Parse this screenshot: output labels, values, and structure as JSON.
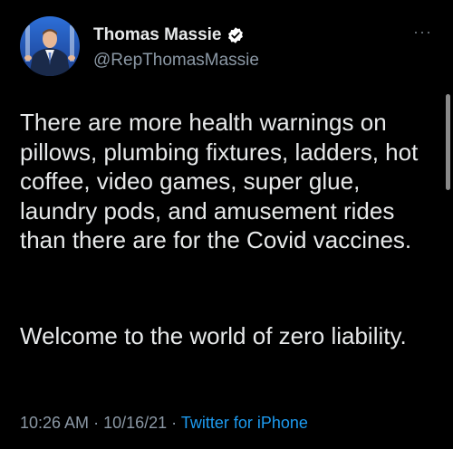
{
  "tweet": {
    "author": {
      "name": "Thomas Massie",
      "handle": "@RepThomasMassie"
    },
    "more_label": "···",
    "paragraphs": [
      "There are more health warnings on pillows, plumbing fixtures, ladders, hot coffee, video games, super glue, laundry pods, and amusement rides than there are for the Covid vaccines.",
      "Welcome to the world of zero liability."
    ],
    "time": "10:26 AM",
    "separator1": " · ",
    "date": "10/16/21",
    "separator2": " · ",
    "source": "Twitter for iPhone"
  },
  "colors": {
    "background": "#000000",
    "text": "#e7e9ea",
    "secondary": "#8b98a5",
    "link": "#1d9bf0",
    "verified_badge": "#ffffff"
  }
}
